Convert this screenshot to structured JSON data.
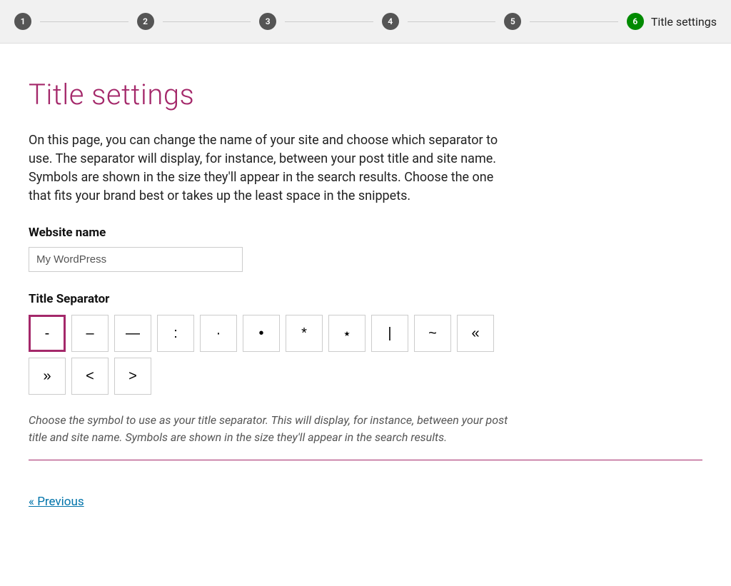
{
  "stepper": {
    "steps": [
      {
        "num": "1",
        "label": "",
        "active": false
      },
      {
        "num": "2",
        "label": "",
        "active": false
      },
      {
        "num": "3",
        "label": "",
        "active": false
      },
      {
        "num": "4",
        "label": "",
        "active": false
      },
      {
        "num": "5",
        "label": "",
        "active": false
      },
      {
        "num": "6",
        "label": "Title settings",
        "active": true
      }
    ]
  },
  "page": {
    "title": "Title settings",
    "intro": "On this page, you can change the name of your site and choose which separator to use. The separator will display, for instance, between your post title and site name. Symbols are shown in the size they'll appear in the search results. Choose the one that fits your brand best or takes up the least space in the snippets."
  },
  "website_name": {
    "label": "Website name",
    "value": "My WordPress"
  },
  "separator": {
    "label": "Title Separator",
    "options": [
      "-",
      "–",
      "—",
      ":",
      "·",
      "•",
      "*",
      "⋆",
      "|",
      "~",
      "«",
      "»",
      "<",
      ">"
    ],
    "selected_index": 0,
    "hint": "Choose the symbol to use as your title separator. This will display, for instance, between your post title and site name. Symbols are shown in the size they'll appear in the search results."
  },
  "nav": {
    "previous": "« Previous"
  }
}
